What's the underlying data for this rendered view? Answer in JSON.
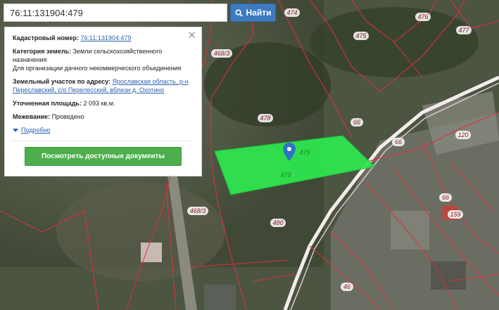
{
  "search": {
    "value": "76:11:131904:479",
    "button_label": "Найти"
  },
  "panel": {
    "cadastral_label": "Кадастровый номер:",
    "cadastral_value": "76:11:131904:479",
    "category_label": "Категория земель:",
    "category_value": "Земли сельскохозяйственного назначения",
    "usage": "Для организации дачного некоммерческого объединения",
    "address_label": "Земельный участок по адресу:",
    "address_value": "Ярославская область, р-н Переславский, с/о Перелесский, вблизи д. Охотино",
    "area_label": "Уточненная площадь:",
    "area_value": "2 093 кв.м.",
    "survey_label": "Межевание:",
    "survey_value": "Проведено",
    "more_label": "Подробно",
    "docs_button": "Посмотреть доступные документы"
  },
  "map": {
    "labels": [
      {
        "id": "l474",
        "text": "474"
      },
      {
        "id": "l476",
        "text": "476"
      },
      {
        "id": "l477",
        "text": "477"
      },
      {
        "id": "l475",
        "text": "475"
      },
      {
        "id": "l4683a",
        "text": "468/3"
      },
      {
        "id": "l478",
        "text": "478"
      },
      {
        "id": "l66a",
        "text": "66"
      },
      {
        "id": "l66b",
        "text": "66"
      },
      {
        "id": "l120",
        "text": "120"
      },
      {
        "id": "l479a",
        "text": "479"
      },
      {
        "id": "l479b",
        "text": "479"
      },
      {
        "id": "l66c",
        "text": "66"
      },
      {
        "id": "l159",
        "text": "159"
      },
      {
        "id": "l4683b",
        "text": "468/3"
      },
      {
        "id": "l480",
        "text": "480"
      },
      {
        "id": "l46",
        "text": "46"
      }
    ]
  },
  "colors": {
    "parcel_fill": "#2ee54f",
    "boundary": "#e0303a",
    "road": "#f0e4e4",
    "marker": "#2e73c4",
    "button_green": "#4cae4c",
    "button_blue": "#3c7bbf"
  },
  "icons": {
    "search": "search-icon",
    "close": "close-icon",
    "marker": "map-marker-icon",
    "expand": "caret-down-icon"
  }
}
